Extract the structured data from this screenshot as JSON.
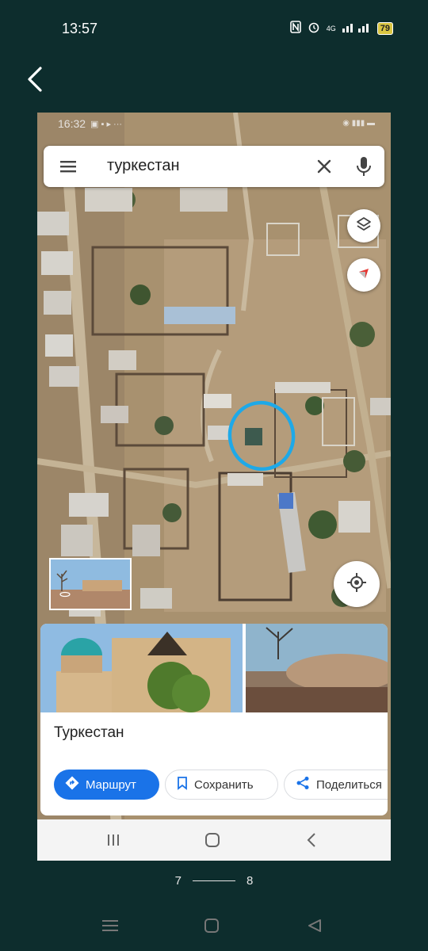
{
  "status_bar": {
    "time": "13:57",
    "network": "4G",
    "battery": "79"
  },
  "inner_status": {
    "time": "16:32"
  },
  "search": {
    "query": "туркестан"
  },
  "place": {
    "name": "Туркестан"
  },
  "actions": {
    "route_label": "Маршрут",
    "save_label": "Сохранить",
    "share_label": "Поделиться"
  },
  "pager": {
    "current": "7",
    "total": "8"
  },
  "colors": {
    "background": "#0d2d2d",
    "accent": "#1a73e8",
    "circle_marker": "#1ea9e8"
  }
}
